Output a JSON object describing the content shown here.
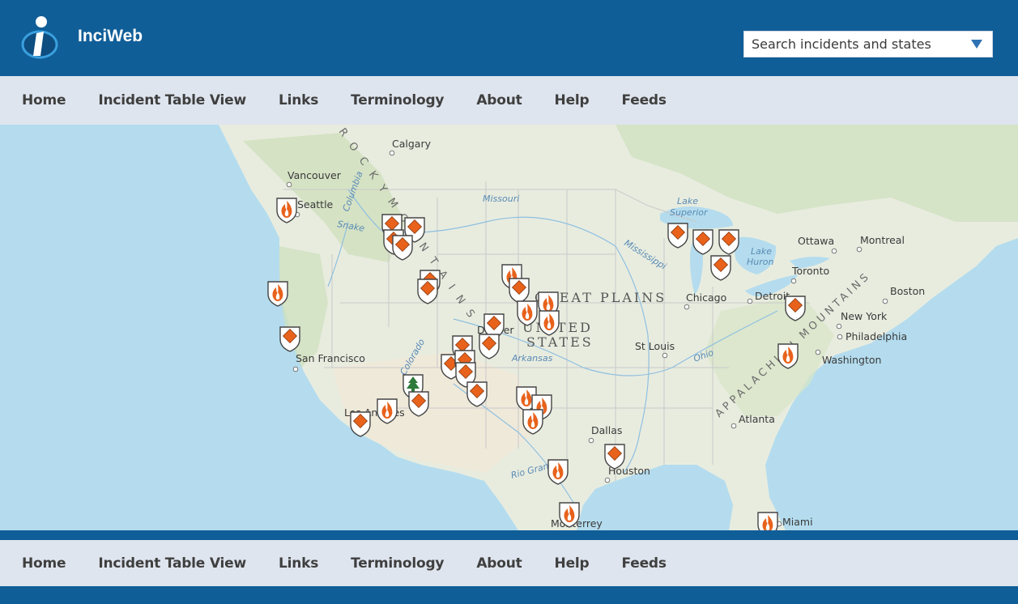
{
  "header": {
    "brand": "InciWeb",
    "search_placeholder": "Search incidents and states"
  },
  "nav": {
    "items": [
      "Home",
      "Incident Table View",
      "Links",
      "Terminology",
      "About",
      "Help",
      "Feeds"
    ]
  },
  "map": {
    "labels": {
      "calgary": "Calgary",
      "vancouver": "Vancouver",
      "seattle": "Seattle",
      "san_francisco": "San Francisco",
      "los_angeles": "Los Angeles",
      "denver": "Denver",
      "dallas": "Dallas",
      "houston": "Houston",
      "st_louis": "St Louis",
      "chicago": "Chicago",
      "detroit": "Detroit",
      "toronto": "Toronto",
      "ottawa": "Ottawa",
      "montreal": "Montreal",
      "boston": "Boston",
      "new_york": "New York",
      "philadelphia": "Philadelphia",
      "washington": "Washington",
      "atlanta": "Atlanta",
      "miami": "Miami",
      "monterrey": "Monterrey",
      "great_plains": "GREAT PLAINS",
      "united": "UNITED",
      "states": "STATES",
      "missouri": "Missouri",
      "lake_superior_1": "Lake",
      "lake_superior_2": "Superior",
      "lake_huron_1": "Lake",
      "lake_huron_2": "Huron",
      "mississippi": "Mississippi",
      "arkansas": "Arkansas",
      "ohio": "Ohio",
      "rio_grande": "Rio Grande",
      "snake": "Snake",
      "columbia": "Columbia",
      "colorado": "Colorado",
      "rocky_mtns": "R O C K Y   M O U N T A I N S",
      "appalachian": "APPALACHIAN MOUNTAINS"
    },
    "colors": {
      "ocean": "#b4dcee",
      "land": "#e9ede3",
      "forest": "#cfe0bd",
      "desert": "#f0ead9",
      "marker": "#e8621c"
    },
    "markers": [
      {
        "kind": "fire",
        "name": "fire-icon"
      },
      {
        "kind": "diamond",
        "name": "incident-diamond-icon"
      },
      {
        "kind": "tree",
        "name": "prescribed-fire-icon"
      }
    ]
  },
  "footer_nav": {
    "items": [
      "Home",
      "Incident Table View",
      "Links",
      "Terminology",
      "About",
      "Help",
      "Feeds"
    ]
  }
}
